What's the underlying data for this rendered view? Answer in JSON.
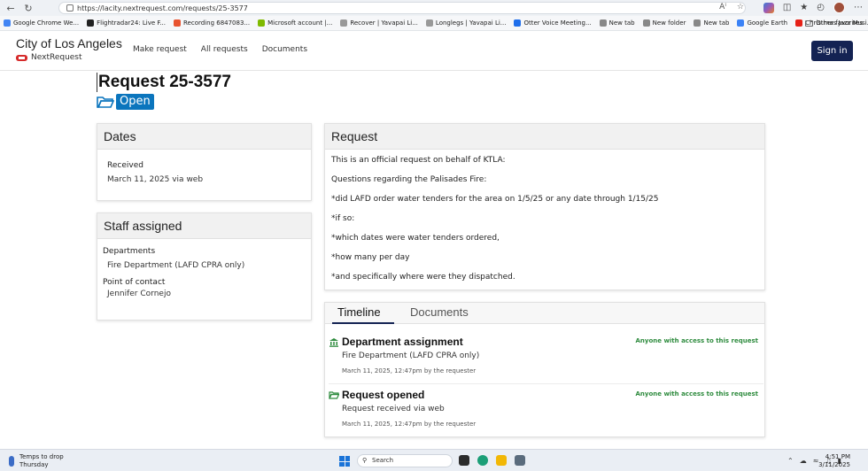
{
  "browser": {
    "url": "https://lacity.nextrequest.com/requests/25-3577",
    "bookmarks": [
      {
        "label": "Google Chrome We...",
        "color": "#4285f4"
      },
      {
        "label": "Flightradar24: Live F...",
        "color": "#222222"
      },
      {
        "label": "Recording 6847083...",
        "color": "#e8532f"
      },
      {
        "label": "Microsoft account |...",
        "color": "#7fba00"
      },
      {
        "label": "Recover | Yavapai Li...",
        "color": "#999999"
      },
      {
        "label": "Longlegs | Yavapai Li...",
        "color": "#999999"
      },
      {
        "label": "Otter Voice Meeting...",
        "color": "#1f6feb"
      },
      {
        "label": "New tab",
        "color": "#888888"
      },
      {
        "label": "New folder",
        "color": "#888888"
      },
      {
        "label": "New tab",
        "color": "#888888"
      },
      {
        "label": "Google Earth",
        "color": "#3b82f6"
      },
      {
        "label": "Christmas Jazz Musi...",
        "color": "#e62117"
      }
    ],
    "other_favorites": "Other favorites"
  },
  "header": {
    "brand_title": "City of Los Angeles",
    "brand_sub": "NextRequest",
    "nav": [
      "Make request",
      "All requests",
      "Documents"
    ],
    "signin_label": "Sign in"
  },
  "request": {
    "title": "Request 25-3577",
    "status": "Open"
  },
  "dates": {
    "heading": "Dates",
    "received_label": "Received",
    "received_value": "March 11, 2025 via web"
  },
  "staff": {
    "heading": "Staff assigned",
    "departments_label": "Departments",
    "departments_value": "Fire Department (LAFD CPRA only)",
    "contact_label": "Point of contact",
    "contact_value": "Jennifer Cornejo"
  },
  "request_body": {
    "heading": "Request",
    "lines": [
      "This is an official request on behalf of KTLA:",
      "Questions regarding the Palisades Fire:",
      "*did LAFD order water tenders for the area on 1/5/25 or any date through 1/15/25",
      "*if so:",
      "*which dates were water tenders ordered,",
      "*how many per day",
      "*and specifically where were they dispatched."
    ]
  },
  "timeline": {
    "tabs": [
      "Timeline",
      "Documents"
    ],
    "events": [
      {
        "title": "Department assignment",
        "visibility": "Anyone with access to this request",
        "desc": "Fire Department (LAFD CPRA only)",
        "time": "March 11, 2025, 12:47pm by the requester"
      },
      {
        "title": "Request opened",
        "visibility": "Anyone with access to this request",
        "desc": "Request received via web",
        "time": "March 11, 2025, 12:47pm by the requester"
      }
    ]
  },
  "taskbar": {
    "weather_line1": "Temps to drop",
    "weather_line2": "Thursday",
    "search_placeholder": "Search",
    "time": "4:51 PM",
    "date": "3/11/2025"
  },
  "colors": {
    "brand_navy": "#142353",
    "status_blue": "#0b75bd",
    "visibility_green": "#2e8b3e"
  }
}
